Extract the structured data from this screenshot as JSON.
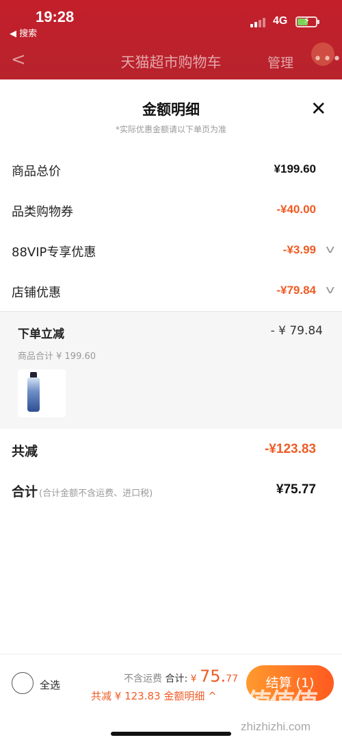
{
  "status": {
    "time": "19:28",
    "back_app": "◀ 搜索",
    "network": "4G"
  },
  "nav": {
    "back_glyph": "<",
    "title": "天猫超市购物车",
    "manage": "管理",
    "more_glyph": "•••"
  },
  "sheet": {
    "title": "金额明细",
    "subtitle": "*实际优惠金额请以下单页为准",
    "close_glyph": "✕",
    "rows": [
      {
        "label": "商品总价",
        "value": "¥199.60"
      },
      {
        "label": "品类购物券",
        "value": "-¥40.00"
      },
      {
        "label": "88VIP专享优惠",
        "value": "-¥3.99"
      },
      {
        "label": "店铺优惠",
        "value": "-¥79.84"
      }
    ],
    "detail": {
      "title": "下单立减",
      "amount": "- ¥ 79.84",
      "subtotal": "商品合计 ¥ 199.60"
    },
    "total_discount": {
      "label": "共减",
      "value": "-¥123.83"
    },
    "grand_total": {
      "label": "合计",
      "note": "(合计金额不含运费、进口税)",
      "value": "¥75.77"
    }
  },
  "bottom": {
    "select_all": "全选",
    "no_shipping": "不含运费",
    "total_label": "合计:",
    "currency": "¥",
    "amount_int": "75.",
    "amount_dec": "77",
    "discount_line": "共减 ¥ 123.83  金额明细 ^",
    "checkout": "结算 (1)"
  },
  "watermark": {
    "logo": "值值值",
    "text": "zhizhizhi.com"
  },
  "colors": {
    "brand_red": "#c31f2b",
    "discount_orange": "#ef5b24",
    "checkout_gradient_start": "#ff9a2e",
    "checkout_gradient_end": "#ff5a1f"
  },
  "icons": {
    "battery_charging": "battery-icon",
    "chevron": "chevron-down-icon"
  }
}
